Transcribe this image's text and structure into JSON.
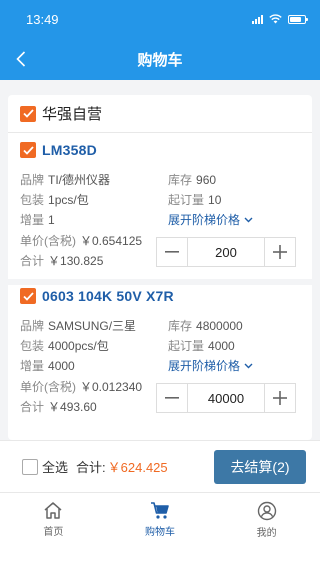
{
  "status": {
    "time": "13:49"
  },
  "nav": {
    "title": "购物车"
  },
  "store": {
    "name": "华强自营"
  },
  "labels": {
    "brand": "品牌",
    "package": "包装",
    "increment": "增量",
    "unit_price": "单价(含税)",
    "subtotal": "合计",
    "stock": "库存",
    "moq": "起订量",
    "tier_link": "展开阶梯价格"
  },
  "products": [
    {
      "name": "LM358D",
      "brand": "TI/德州仪器",
      "package": "1pcs/包",
      "increment": "1",
      "unit_price": "￥0.654125",
      "subtotal": "￥130.825",
      "stock": "960",
      "moq": "10",
      "quantity": "200"
    },
    {
      "name": "0603 104K 50V X7R",
      "brand": "SAMSUNG/三星",
      "package": "4000pcs/包",
      "increment": "4000",
      "unit_price": "￥0.012340",
      "subtotal": "￥493.60",
      "stock": "4800000",
      "moq": "4000",
      "quantity": "40000"
    }
  ],
  "footer": {
    "select_all": "全选",
    "total_label": "合计:",
    "total_value": "￥624.425",
    "checkout": "去结算(2)"
  },
  "tabs": [
    {
      "label": "首页",
      "icon": "home-icon"
    },
    {
      "label": "购物车",
      "icon": "cart-icon",
      "active": true
    },
    {
      "label": "我的",
      "icon": "profile-icon"
    }
  ],
  "colors": {
    "header": "#2496e8",
    "accent": "#f06a23",
    "link": "#1f5ea8",
    "checkout": "#3d78a6"
  }
}
